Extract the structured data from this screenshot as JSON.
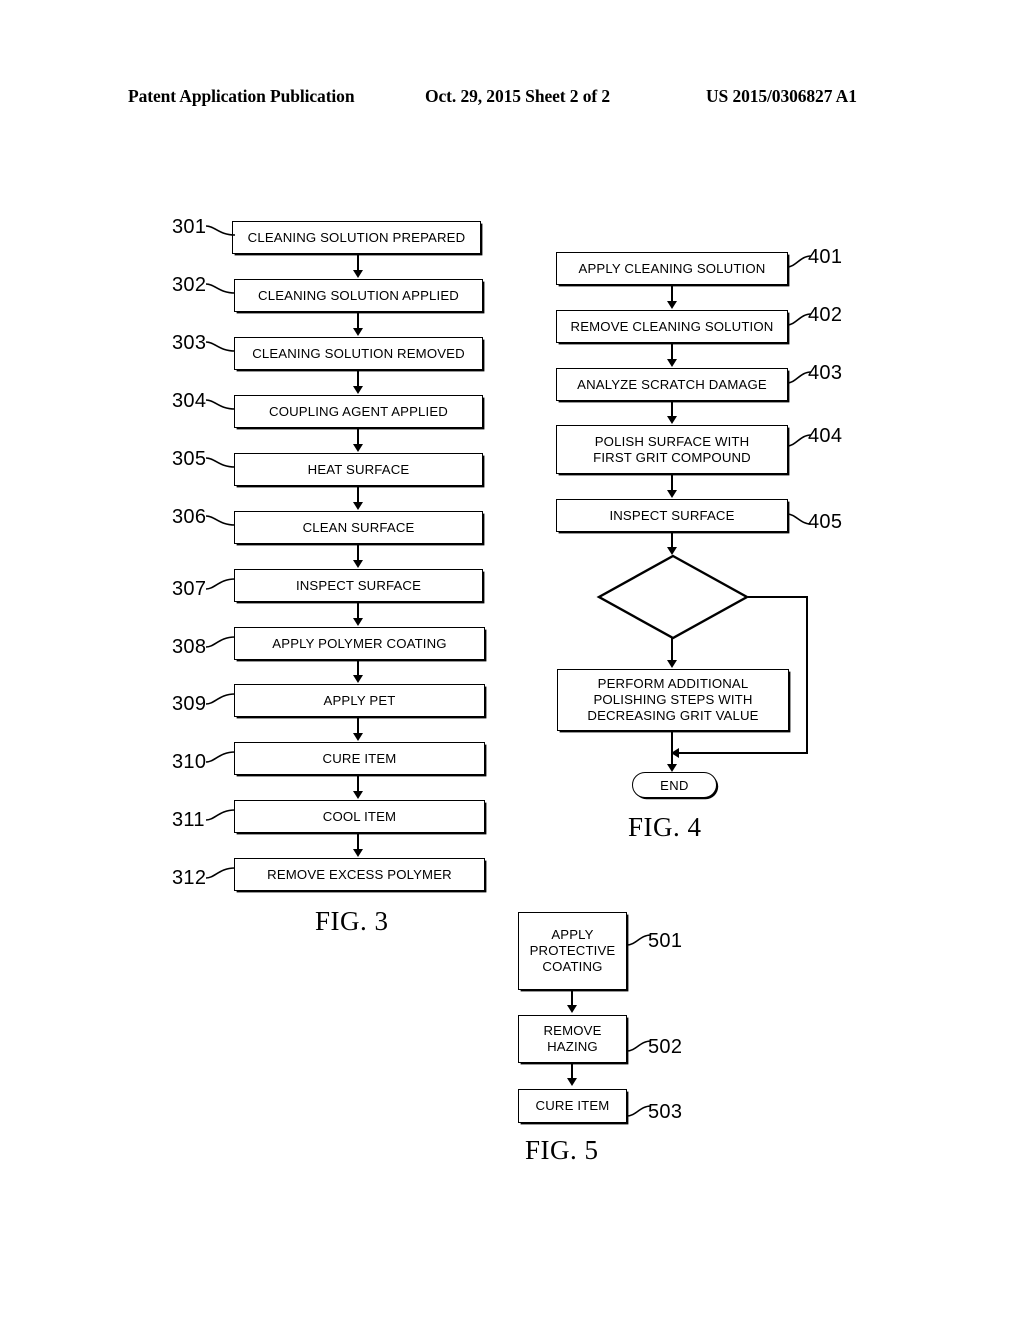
{
  "header": {
    "left": "Patent Application Publication",
    "middle": "Oct. 29, 2015  Sheet 2 of 2",
    "right": "US 2015/0306827 A1"
  },
  "figures": [
    {
      "id": "fig3",
      "caption": "FIG. 3",
      "type": "flowchart",
      "steps": [
        {
          "ref": "301",
          "label": "CLEANING SOLUTION PREPARED"
        },
        {
          "ref": "302",
          "label": "CLEANING SOLUTION APPLIED"
        },
        {
          "ref": "303",
          "label": "CLEANING SOLUTION REMOVED"
        },
        {
          "ref": "304",
          "label": "COUPLING AGENT APPLIED"
        },
        {
          "ref": "305",
          "label": "HEAT SURFACE"
        },
        {
          "ref": "306",
          "label": "CLEAN SURFACE"
        },
        {
          "ref": "307",
          "label": "INSPECT SURFACE"
        },
        {
          "ref": "308",
          "label": "APPLY POLYMER COATING"
        },
        {
          "ref": "309",
          "label": "APPLY PET"
        },
        {
          "ref": "310",
          "label": "CURE ITEM"
        },
        {
          "ref": "311",
          "label": "COOL ITEM"
        },
        {
          "ref": "312",
          "label": "REMOVE EXCESS POLYMER"
        }
      ]
    },
    {
      "id": "fig4",
      "caption": "FIG. 4",
      "type": "flowchart",
      "steps": [
        {
          "ref": "401",
          "label": "APPLY CLEANING SOLUTION"
        },
        {
          "ref": "402",
          "label": "REMOVE CLEANING SOLUTION"
        },
        {
          "ref": "403",
          "label": "ANALYZE SCRATCH DAMAGE"
        },
        {
          "ref": "404",
          "label": "POLISH SURFACE WITH FIRST GRIT COMPOUND"
        },
        {
          "ref": "405",
          "label": "INSPECT SURFACE"
        }
      ],
      "decision": {
        "ref": "",
        "label": ""
      },
      "loop_step": {
        "ref": "",
        "label": "PERFORM ADDITIONAL POLISHING STEPS WITH DECREASING GRIT VALUE"
      },
      "terminator": {
        "label": "END"
      }
    },
    {
      "id": "fig5",
      "caption": "FIG. 5",
      "type": "flowchart",
      "steps": [
        {
          "ref": "501",
          "label": "APPLY PROTECTIVE COATING"
        },
        {
          "ref": "502",
          "label": "REMOVE HAZING"
        },
        {
          "ref": "503",
          "label": "CURE ITEM"
        }
      ]
    }
  ]
}
